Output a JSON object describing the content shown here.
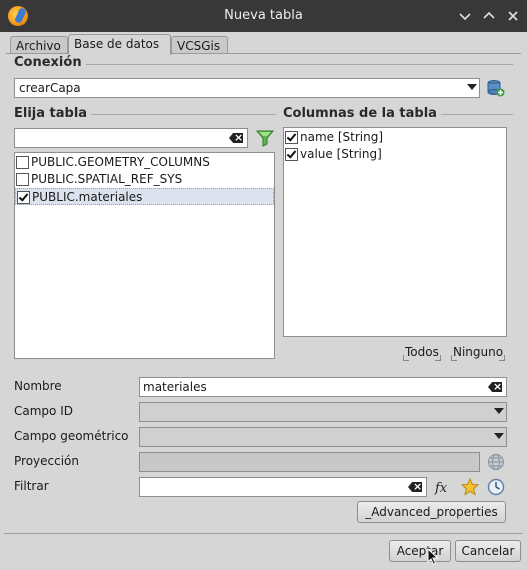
{
  "window": {
    "title": "Nueva tabla"
  },
  "tabs": [
    {
      "label": "Archivo",
      "active": false
    },
    {
      "label": "Base de datos",
      "active": true
    },
    {
      "label": "VCSGis",
      "active": false
    }
  ],
  "connection": {
    "label": "Conexión",
    "value": "crearCapa"
  },
  "table_chooser": {
    "label": "Elija tabla",
    "filter_value": "",
    "tables": [
      {
        "name": "PUBLIC.GEOMETRY_COLUMNS",
        "checked": false,
        "selected": false
      },
      {
        "name": "PUBLIC.SPATIAL_REF_SYS",
        "checked": false,
        "selected": false
      },
      {
        "name": "PUBLIC.materiales",
        "checked": true,
        "selected": true
      }
    ]
  },
  "columns": {
    "label": "Columnas de la tabla",
    "items": [
      {
        "name": "name [String]",
        "checked": true
      },
      {
        "name": "value [String]",
        "checked": true
      }
    ],
    "all_label": "Todos",
    "none_label": "Ninguno"
  },
  "form": {
    "name_label": "Nombre",
    "name_value": "materiales",
    "id_field_label": "Campo ID",
    "id_field_value": "",
    "geom_field_label": "Campo geométrico",
    "geom_field_value": "",
    "projection_label": "Proyección",
    "projection_value": "",
    "filter_label": "Filtrar",
    "filter_value": "",
    "advanced_label": "_Advanced_properties"
  },
  "footer": {
    "accept_label": "Aceptar",
    "cancel_label": "Cancelar"
  }
}
